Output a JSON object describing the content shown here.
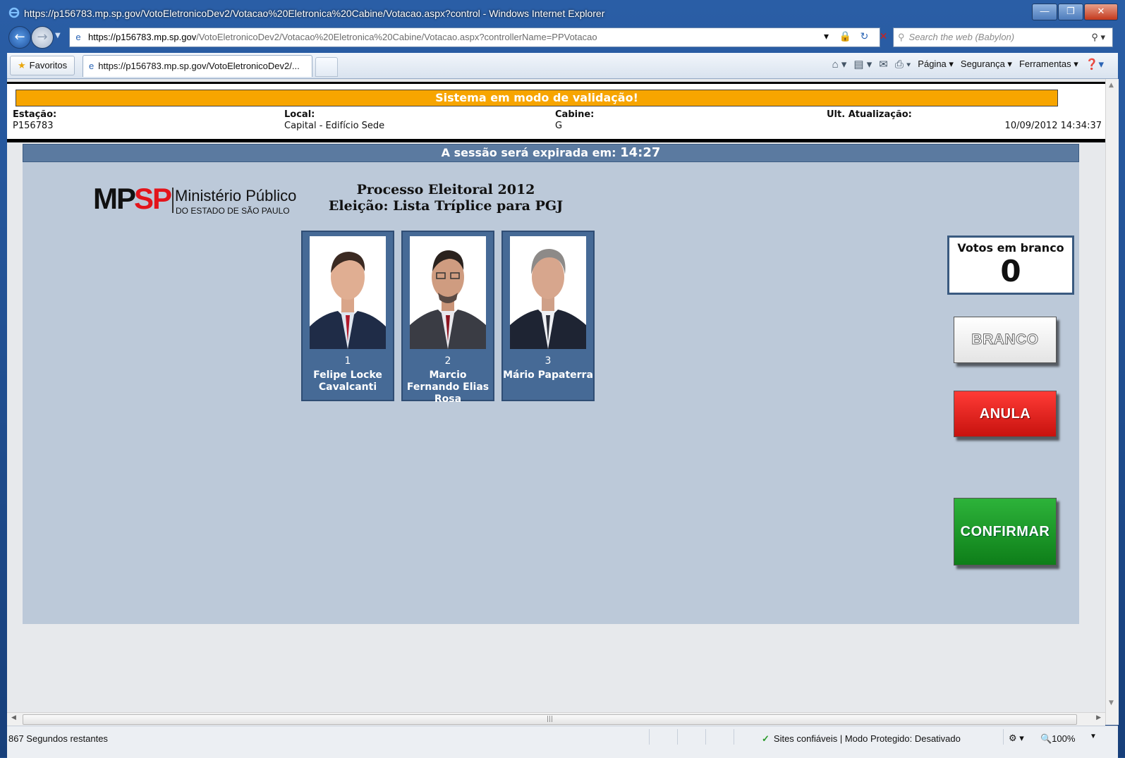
{
  "window": {
    "title": "https://p156783.mp.sp.gov/VotoEletronicoDev2/Votacao%20Eletronica%20Cabine/Votacao.aspx?control - Windows Internet Explorer",
    "minimize": "—",
    "restore": "❐",
    "close": "✕"
  },
  "address": {
    "domain": "https://p156783.mp.sp.gov",
    "path": "/VotoEletronicoDev2/Votacao%20Eletronica%20Cabine/Votacao.aspx?controllerName=PPVotacao"
  },
  "search": {
    "placeholder": "Search the web (Babylon)"
  },
  "tabs": {
    "favorites": "Favoritos",
    "active_tab": "https://p156783.mp.sp.gov/VotoEletronicoDev2/..."
  },
  "commands": {
    "page": "Página ▾",
    "security": "Segurança ▾",
    "tools": "Ferramentas ▾"
  },
  "header": {
    "validation": "Sistema em modo de validação!",
    "station_label": "Estação:",
    "station_value": "P156783",
    "local_label": "Local:",
    "local_value": "Capital - Edifício Sede",
    "cabin_label": "Cabine:",
    "cabin_value": "G",
    "update_label": "Ult. Atualização:",
    "update_value": "10/09/2012 14:34:37"
  },
  "session": {
    "text": "A sessão será expirada em: ",
    "time": "14:27"
  },
  "logo": {
    "mp": "MP",
    "sp": "SP",
    "name": "Ministério Público",
    "state": "DO ESTADO DE SÃO PAULO"
  },
  "election": {
    "line1": "Processo Eleitoral 2012",
    "line2": "Eleição: Lista Tríplice para PGJ"
  },
  "candidates": [
    {
      "number": "1",
      "name": "Felipe Locke Cavalcanti"
    },
    {
      "number": "2",
      "name": "Marcio Fernando Elias Rosa"
    },
    {
      "number": "3",
      "name": "Mário Papaterra"
    }
  ],
  "blank_votes": {
    "label": "Votos em branco",
    "count": "0"
  },
  "buttons": {
    "branco": "BRANCO",
    "anula": "ANULA",
    "confirmar": "CONFIRMAR"
  },
  "status": {
    "left": "867 Segundos restantes",
    "zone": "Sites confiáveis | Modo Protegido: Desativado",
    "zoom": "🔍100%"
  },
  "colors": {
    "validation": "#f7a500",
    "session_bar": "#5b7aa0",
    "panel": "#bcc9d9",
    "anula": "#e0201b",
    "confirmar": "#1a9a28"
  }
}
